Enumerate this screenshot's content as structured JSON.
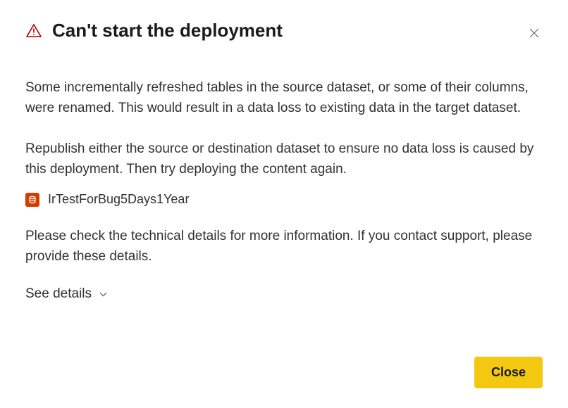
{
  "dialog": {
    "title": "Can't start the deployment",
    "paragraph1": "Some incrementally refreshed tables in the source dataset, or some of their columns, were renamed. This would result in a data loss to existing data in the target dataset.",
    "paragraph2": "Republish either the source or destination dataset to ensure no data loss is caused by this deployment. Then try deploying the content again.",
    "dataset_name": "IrTestForBug5Days1Year",
    "paragraph3": "Please check the technical details for more information. If you contact support, please provide these details.",
    "see_details_label": "See details",
    "close_button_label": "Close"
  },
  "colors": {
    "warning_icon": "#a80000",
    "dataset_icon_bg": "#d83b01",
    "primary_button_bg": "#f2c811"
  }
}
